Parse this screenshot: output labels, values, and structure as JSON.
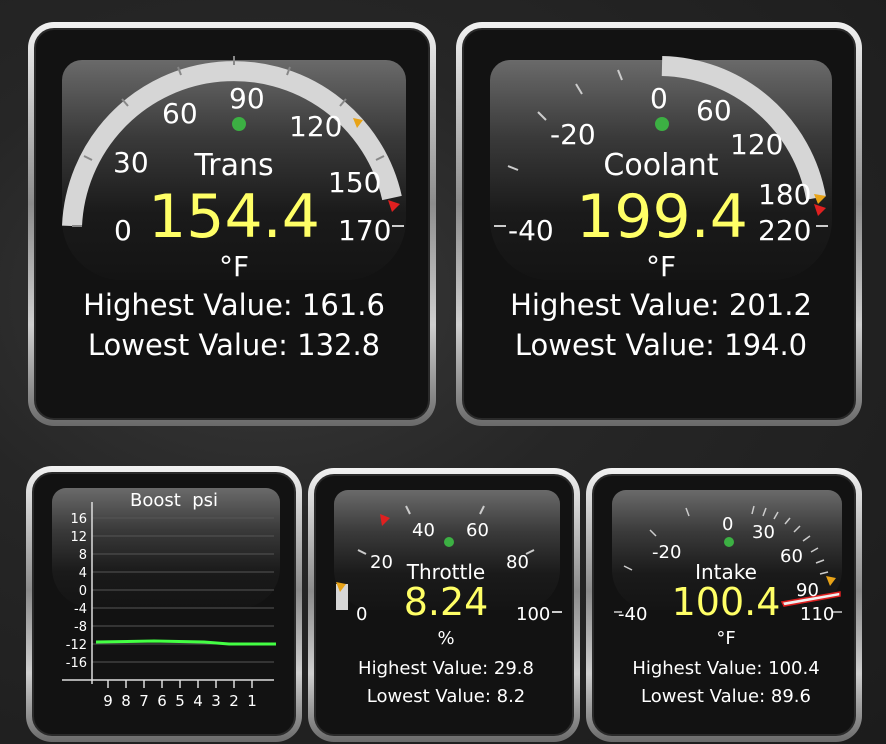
{
  "trans": {
    "label": "Trans",
    "value": "154.4",
    "unit": "°F",
    "highest": "Highest Value: 161.6",
    "lowest": "Lowest Value: 132.8",
    "ticks": [
      "0",
      "30",
      "60",
      "90",
      "120",
      "150",
      "170"
    ]
  },
  "coolant": {
    "label": "Coolant",
    "value": "199.4",
    "unit": "°F",
    "highest": "Highest Value: 201.2",
    "lowest": "Lowest Value: 194.0",
    "ticks": [
      "-40",
      "-20",
      "0",
      "60",
      "120",
      "180",
      "220"
    ]
  },
  "boost": {
    "label": "Boost  psi",
    "y_ticks": [
      "16",
      "12",
      "8",
      "4",
      "0",
      "-4",
      "-8",
      "-12",
      "-16"
    ],
    "x_ticks": [
      "9",
      "8",
      "7",
      "6",
      "5",
      "4",
      "3",
      "2",
      "1"
    ]
  },
  "throttle": {
    "label": "Throttle",
    "value": "8.24",
    "unit": "%",
    "highest": "Highest Value: 29.8",
    "lowest": "Lowest Value: 8.2",
    "ticks": [
      "0",
      "20",
      "40",
      "60",
      "80",
      "100"
    ]
  },
  "intake": {
    "label": "Intake",
    "value": "100.4",
    "unit": "°F",
    "highest": "Highest Value: 100.4",
    "lowest": "Lowest Value: 89.6",
    "ticks": [
      "-40",
      "-20",
      "0",
      "30",
      "60",
      "90",
      "110"
    ]
  },
  "colors": {
    "value": "#ffff66",
    "dot": "#3cb043",
    "marker_high": "#e8a317",
    "marker_low": "#e02020",
    "trace": "#44ff44"
  }
}
